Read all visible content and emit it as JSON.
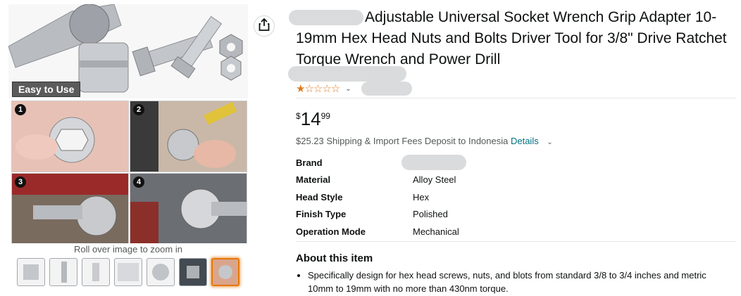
{
  "gallery": {
    "easy_label": "Easy to Use",
    "steps": [
      "1",
      "2",
      "3",
      "4"
    ],
    "zoom_hint": "Roll over image to zoom in",
    "thumbnail_count": 7,
    "selected_thumbnail": 7
  },
  "product": {
    "title": "Adjustable Universal Socket Wrench Grip Adapter 10-19mm Hex Head Nuts and Bolts Driver Tool for 3/8\" Drive Ratchet Torque Wrench and Power Drill",
    "rating_stars": "★☆☆☆☆",
    "rating_value": 1,
    "price": {
      "symbol": "$",
      "whole": "14",
      "fraction": "99"
    },
    "shipping_text": "$25.23 Shipping & Import Fees Deposit to Indonesia ",
    "shipping_link": "Details",
    "specs": [
      {
        "key": "Brand",
        "value": ""
      },
      {
        "key": "Material",
        "value": "Alloy Steel"
      },
      {
        "key": "Head Style",
        "value": "Hex"
      },
      {
        "key": "Finish Type",
        "value": "Polished"
      },
      {
        "key": "Operation Mode",
        "value": "Mechanical"
      }
    ],
    "about_title": "About this item",
    "bullets": [
      "Specifically design for hex head screws, nuts, and blots from standard 3/8 to 3/4 inches and metric 10mm to 19mm with no more than 430nm torque."
    ]
  },
  "icons": {
    "share": "share-icon",
    "chevron": "chevron-down-icon"
  },
  "colors": {
    "star": "#de7921",
    "link": "#007185",
    "selected_thumb": "#e77600"
  }
}
